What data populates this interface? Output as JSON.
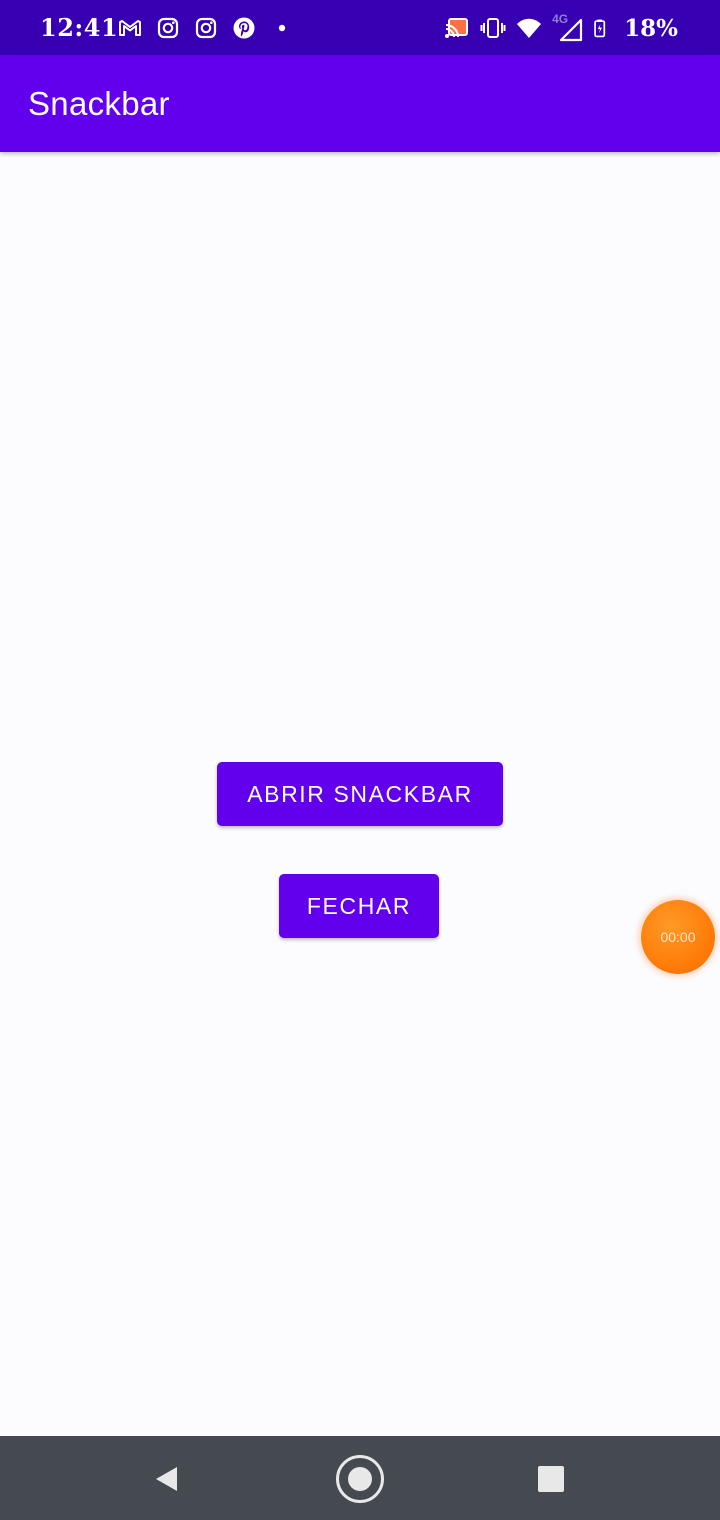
{
  "status_bar": {
    "time": "12:41",
    "battery_percent": "18%",
    "network_label": "4G",
    "icons_left": [
      "gmail-icon",
      "instagram-icon",
      "instagram-icon",
      "pinterest-icon",
      "dot-icon"
    ],
    "icons_right": [
      "cast-icon",
      "vibrate-icon",
      "wifi-icon",
      "signal-icon",
      "battery-charging-icon"
    ]
  },
  "app_bar": {
    "title": "Snackbar"
  },
  "main": {
    "open_button_label": "ABRIR SNACKBAR",
    "close_button_label": "FECHAR"
  },
  "timer_bubble": {
    "time": "00:00"
  },
  "nav_bar": {
    "icons": [
      "back-icon",
      "home-icon",
      "recents-icon"
    ]
  },
  "colors": {
    "status_bar": "#3700b3",
    "primary": "#6200ee",
    "background": "#fcfcfe",
    "nav_bar": "#444a4f",
    "timer_bubble": "#ff7d0a"
  }
}
